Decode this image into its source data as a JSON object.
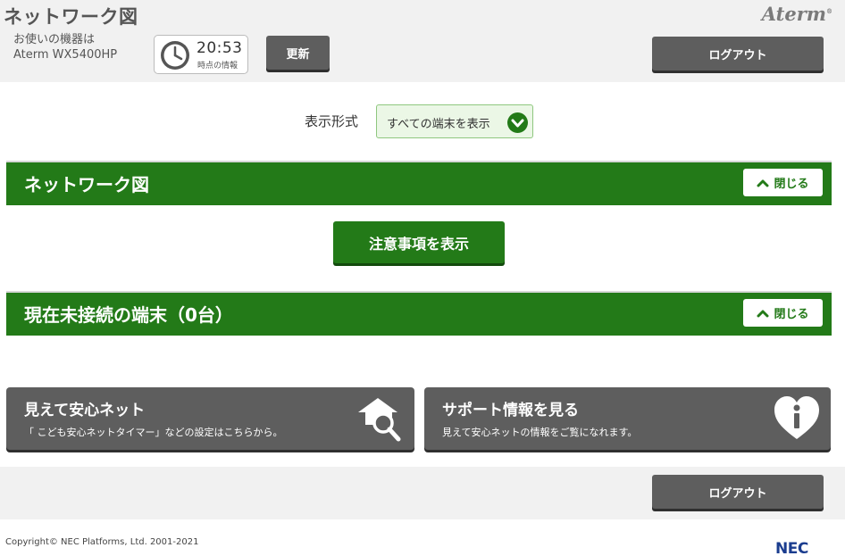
{
  "header": {
    "title": "ネットワーク図",
    "brand": "Aterm",
    "device_label": "お使いの機器は",
    "device_model": "Aterm WX5400HP",
    "clock_time": "20:53",
    "clock_caption": "時点の情報",
    "refresh_label": "更新",
    "logout_label": "ログアウト"
  },
  "display_mode": {
    "label": "表示形式",
    "selected": "すべての端末を表示"
  },
  "sections": [
    {
      "title": "ネットワーク図",
      "close_label": "閉じる"
    },
    {
      "title": "現在未接続の端末（0台）",
      "close_label": "閉じる"
    }
  ],
  "notice_button": "注意事項を表示",
  "cards": [
    {
      "title": "見えて安心ネット",
      "desc": "「 こども安心ネットタイマー」などの設定はこちらから。",
      "icon": "house-search-icon"
    },
    {
      "title": "サポート情報を見る",
      "desc": "見えて安心ネットの情報をご覧になれます。",
      "icon": "heart-info-icon"
    }
  ],
  "footer": {
    "logout_label": "ログアウト",
    "copyright": "Copyright© NEC Platforms, Ltd. 2001-2021",
    "logo": "NEC"
  },
  "colors": {
    "green": "#237a18",
    "dark_button": "#5e5e5e",
    "header_bg": "#f1f1f1"
  }
}
